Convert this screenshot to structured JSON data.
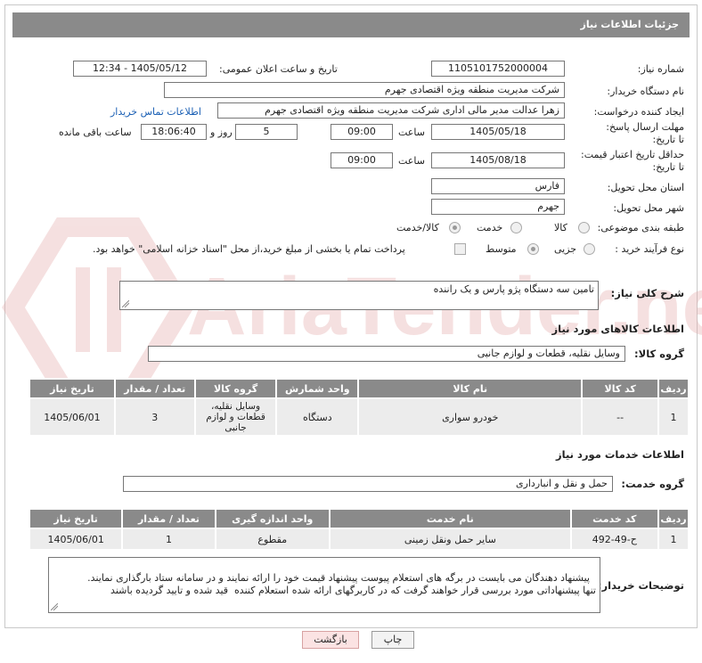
{
  "header": {
    "title": "جزئیات اطلاعات نیاز"
  },
  "form": {
    "need_number_label": "شماره نیاز:",
    "need_number": "1105101752000004",
    "announce_label": "تاریخ و ساعت اعلان عمومی:",
    "announce_value": "1405/05/12 - 12:34",
    "buyer_org_label": "نام دستگاه خریدار:",
    "buyer_org": "شرکت مدیریت منطقه ویژه اقتصادی جهرم",
    "creator_label": "ایجاد کننده درخواست:",
    "creator": "زهرا عدالت مدیر مالی اداری شرکت مدیریت منطقه ویژه اقتصادی جهرم",
    "buyer_contact_link": "اطلاعات تماس خریدار",
    "reply_deadline_label": "مهلت ارسال پاسخ: تا تاریخ:",
    "reply_date": "1405/05/18",
    "time_label": "ساعت",
    "reply_time": "09:00",
    "days_value": "5",
    "days_label": "روز و",
    "remaining_time": "18:06:40",
    "remaining_label": "ساعت باقی مانده",
    "price_validity_label": "حداقل تاریخ اعتبار قیمت: تا تاریخ:",
    "price_date": "1405/08/18",
    "price_time": "09:00",
    "province_label": "استان محل تحویل:",
    "province": "فارس",
    "city_label": "شهر محل تحویل:",
    "city": "جهرم",
    "category_label": "طبقه بندی موضوعی:",
    "category_options": [
      "کالا",
      "خدمت",
      "کالا/خدمت"
    ],
    "process_label": "نوع فرآیند خرید :",
    "process_options": [
      "جزیی",
      "متوسط"
    ],
    "payment_note": "پرداخت تمام یا بخشی از مبلغ خرید،از محل \"اسناد خزانه اسلامی\" خواهد بود."
  },
  "description": {
    "label": "شرح کلی نیاز:",
    "text": "تامین سه دستگاه پژو پارس و یک راننده"
  },
  "goods": {
    "section_title": "اطلاعات کالاهای مورد نیاز",
    "group_label": "گروه کالا:",
    "group_value": "وسایل نقلیه، قطعات و لوازم جانبی",
    "columns": [
      "ردیف",
      "کد کالا",
      "نام کالا",
      "واحد شمارش",
      "گروه کالا",
      "تعداد / مقدار",
      "تاریخ نیاز"
    ],
    "rows": [
      {
        "row": "1",
        "code": "--",
        "name": "خودرو سواری",
        "unit": "دستگاه",
        "group": "وسایل نقلیه، قطعات و لوازم جانبی",
        "qty": "3",
        "date": "1405/06/01"
      }
    ]
  },
  "services": {
    "section_title": "اطلاعات خدمات مورد نیاز",
    "group_label": "گروه خدمت:",
    "group_value": "حمل و نقل و انبارداری",
    "columns": [
      "ردیف",
      "کد خدمت",
      "نام خدمت",
      "واحد اندازه گیری",
      "تعداد / مقدار",
      "تاریخ نیاز"
    ],
    "rows": [
      {
        "row": "1",
        "code": "ح-49-492",
        "name": "سایر حمل ونقل زمینی",
        "unit": "مقطوع",
        "qty": "1",
        "date": "1405/06/01"
      }
    ]
  },
  "buyer_notes": {
    "label": "توضیحات خریدار:",
    "text": "پیشنهاد دهندگان می بایست در برگه های استعلام پیوست پیشنهاد قیمت خود را ارائه نمایند و در سامانه ستاد بارگذاری نمایند.\nتنها پیشنهاداتی مورد بررسی قرار خواهند گرفت که در کاربرگهای ارائه شده استعلام کننده  قید شده و تایید گردیده باشند"
  },
  "buttons": {
    "print": "چاپ",
    "back": "بازگشت"
  },
  "watermark": {
    "text": "AriaTender.net",
    "color": "#e8b9b9"
  }
}
